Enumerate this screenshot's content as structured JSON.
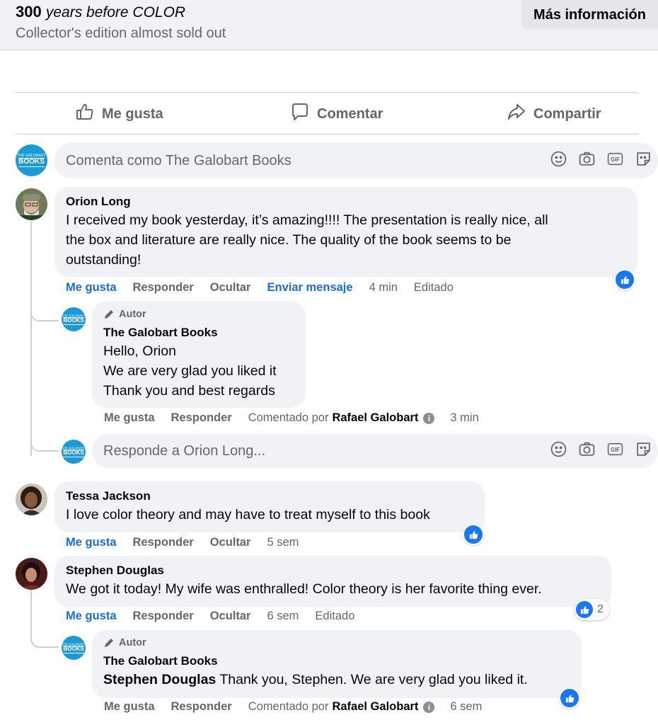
{
  "ad": {
    "title_bold": "300",
    "title_italic": "years before COLOR",
    "subtitle": "Collector's edition almost sold out",
    "cta_label": "Más información"
  },
  "actions": {
    "like": "Me gusta",
    "comment": "Comentar",
    "share": "Compartir"
  },
  "composer": {
    "placeholder": "Comenta como The Galobart Books",
    "icons": [
      "smile-icon",
      "camera-icon",
      "gif-icon",
      "sticker-icon"
    ]
  },
  "brand_avatar": {
    "line1": "THE GALOBART",
    "line2": "BOOKS",
    "color": "#1a9bd7"
  },
  "comments": [
    {
      "name": "Orion Long",
      "text_lines": [
        "I received my book yesterday, it’s amazing!!!! The presentation is really nice, all",
        "the box and literature are really nice. The quality of the book seems to be",
        "outstanding!"
      ],
      "meta": {
        "like": "Me gusta",
        "reply": "Responder",
        "hide": "Ocultar",
        "message": "Enviar mensaje",
        "time": "4 min",
        "edited": "Editado"
      },
      "reply": {
        "author_badge": "Autor",
        "name": "The Galobart Books",
        "text_lines": [
          "Hello, Orion",
          "We are very glad you liked it",
          "Thank you and best regards"
        ],
        "meta": {
          "like": "Me gusta",
          "reply": "Responder",
          "commented_by": "Comentado por",
          "commenter": "Rafael Galobart",
          "time": "3 min"
        }
      },
      "reply_input": "Responde a Orion Long..."
    },
    {
      "name": "Tessa Jackson",
      "text": "I love color theory and may have to treat myself to this book",
      "meta": {
        "like": "Me gusta",
        "reply": "Responder",
        "hide": "Ocultar",
        "time": "5 sem"
      }
    },
    {
      "name": "Stephen Douglas",
      "text": "We got it today! My wife was enthralled! Color theory is her favorite thing ever.",
      "reaction_count": "2",
      "meta": {
        "like": "Me gusta",
        "reply": "Responder",
        "hide": "Ocultar",
        "time": "6 sem",
        "edited": "Editado"
      },
      "reply": {
        "author_badge": "Autor",
        "name": "The Galobart Books",
        "mention": "Stephen Douglas",
        "text": "Thank you, Stephen. We are very glad you liked it.",
        "meta": {
          "like": "Me gusta",
          "reply": "Responder",
          "commented_by": "Comentado por",
          "commenter": "Rafael Galobart",
          "time": "6 sem"
        }
      }
    }
  ],
  "colors": {
    "link_blue": "#1a6ed8",
    "reaction_blue": "#1877f2",
    "bubble_gray": "#f0f2f5",
    "secondary_text": "#65676b"
  }
}
